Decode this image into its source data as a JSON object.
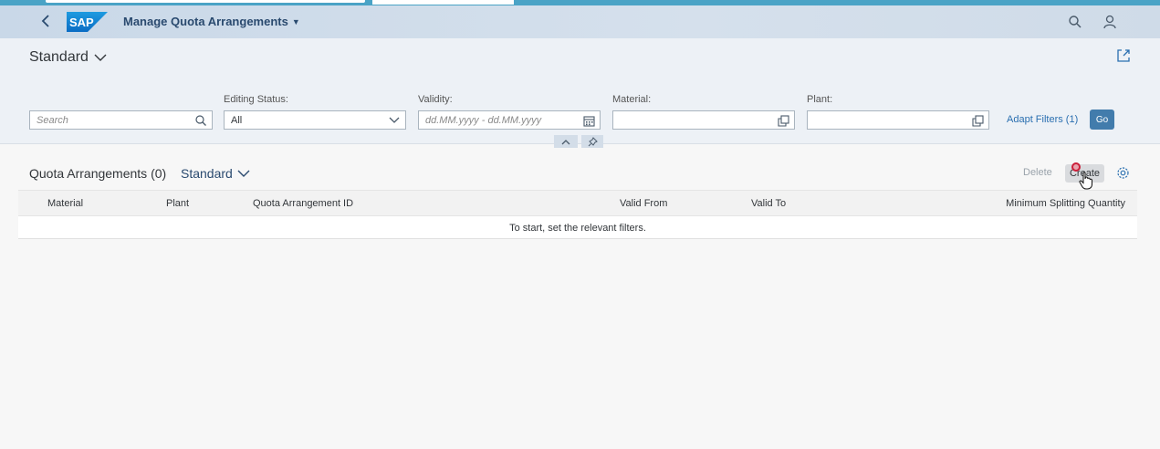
{
  "shell": {
    "app_title": "Manage Quota Arrangements",
    "logo_text": "SAP"
  },
  "filterbar": {
    "variant": "Standard",
    "search": {
      "placeholder": "Search"
    },
    "editing_status": {
      "label": "Editing Status:",
      "value": "All"
    },
    "validity": {
      "label": "Validity:",
      "placeholder": "dd.MM.yyyy - dd.MM.yyyy"
    },
    "material": {
      "label": "Material:",
      "value": ""
    },
    "plant": {
      "label": "Plant:",
      "value": ""
    },
    "adapt_filters": "Adapt Filters (1)",
    "go": "Go"
  },
  "table": {
    "title": "Quota Arrangements (0)",
    "variant": "Standard",
    "delete_label": "Delete",
    "create_label": "Create",
    "columns": [
      "Material",
      "Plant",
      "Quota Arrangement ID",
      "Valid From",
      "Valid To",
      "Minimum Splitting Quantity"
    ],
    "empty_message": "To start, set the relevant filters."
  },
  "colors": {
    "brand_blue": "#427cac",
    "link_blue": "#2a6fb0",
    "shell_bg": "#cfdbe8",
    "cursor_highlight": "#cc1f3a"
  }
}
